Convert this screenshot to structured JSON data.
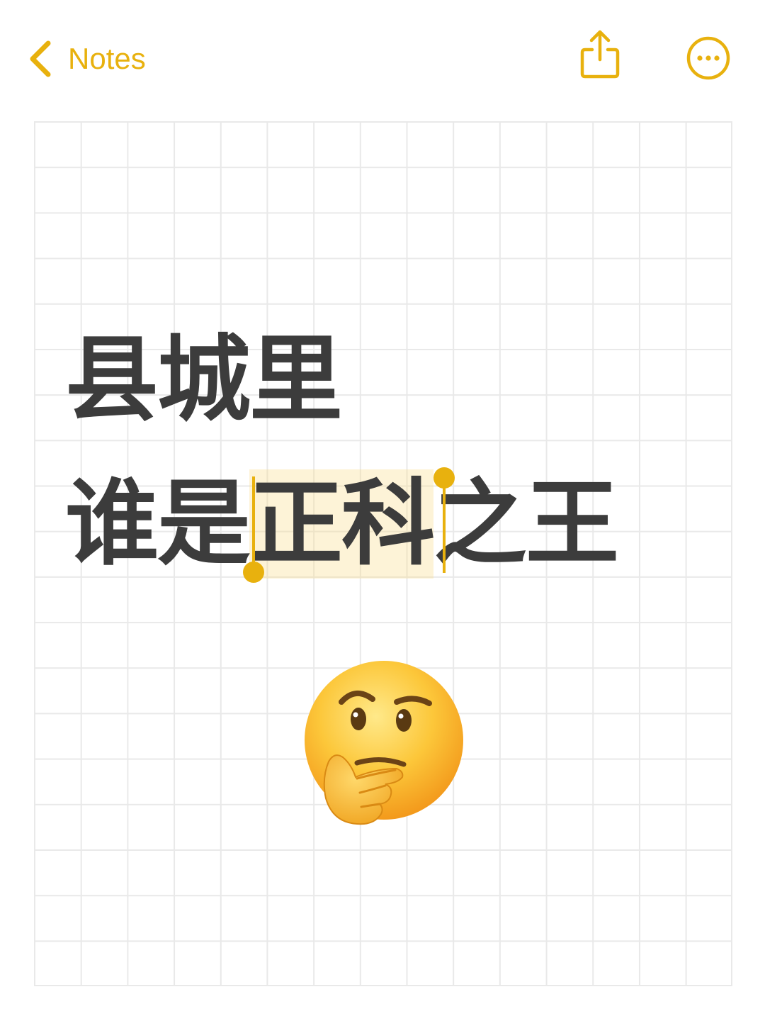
{
  "navbar": {
    "back_label": "Notes",
    "back_icon": "chevron-left-icon",
    "share_icon": "share-icon",
    "more_icon": "ellipsis-circle-icon"
  },
  "note": {
    "line_1": "县城里",
    "line_2_before": "谁是",
    "line_2_selected": "正科",
    "line_2_after": "之王",
    "emoji": "thinking-face-emoji"
  },
  "colors": {
    "accent": "#e8b10e",
    "text": "#3c3c3c",
    "grid_line": "#e9e9e9",
    "selection": "#fbf0d2"
  }
}
